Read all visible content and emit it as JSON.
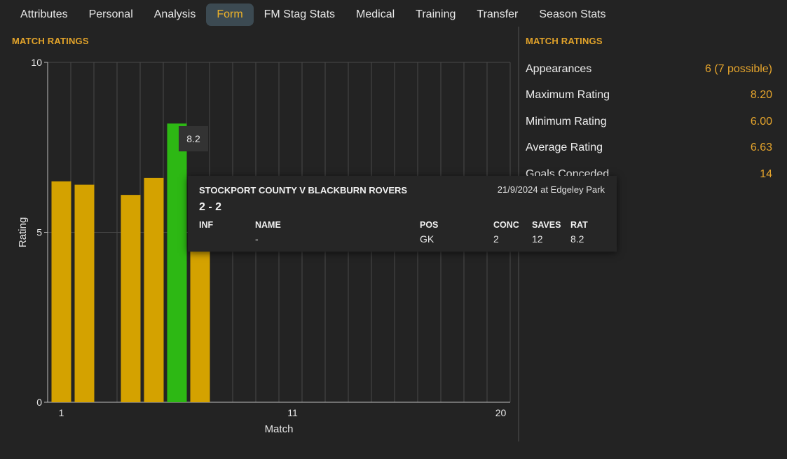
{
  "tabs": [
    {
      "label": "Attributes"
    },
    {
      "label": "Personal"
    },
    {
      "label": "Analysis"
    },
    {
      "label": "Form",
      "active": true
    },
    {
      "label": "FM Stag Stats"
    },
    {
      "label": "Medical"
    },
    {
      "label": "Training"
    },
    {
      "label": "Transfer"
    },
    {
      "label": "Season Stats"
    }
  ],
  "left_title": "MATCH RATINGS",
  "right_title": "MATCH RATINGS",
  "stats": [
    {
      "label": "Appearances",
      "value": "6 (7 possible)"
    },
    {
      "label": "Maximum Rating",
      "value": "8.20"
    },
    {
      "label": "Minimum Rating",
      "value": "6.00"
    },
    {
      "label": "Average Rating",
      "value": "6.63"
    },
    {
      "label": "Goals Conceded",
      "value": "14"
    }
  ],
  "chart_data": {
    "type": "bar",
    "xlabel": "Match",
    "ylabel": "Rating",
    "x_ticks": [
      "1",
      "11",
      "20"
    ],
    "y_ticks": [
      "0",
      "5",
      "10"
    ],
    "ylim": [
      0,
      10
    ],
    "xlim": [
      1,
      20
    ],
    "matches": [
      1,
      2,
      3,
      4,
      5,
      6,
      7
    ],
    "values": [
      6.5,
      6.4,
      null,
      6.1,
      6.6,
      8.2,
      5.0
    ],
    "highlight_index": 5,
    "colors": {
      "bar": "#d4a200",
      "highlight": "#2db814",
      "grid": "#4a4a4a",
      "axis": "#bdbdbd"
    }
  },
  "hover_value": "8.2",
  "popup": {
    "title": "STOCKPORT COUNTY V BLACKBURN ROVERS",
    "date": "21/9/2024 at Edgeley Park",
    "score": "2 - 2",
    "headers": {
      "inf": "INF",
      "name": "NAME",
      "pos": "POS",
      "conc": "CONC",
      "saves": "SAVES",
      "rat": "RAT"
    },
    "row": {
      "name": "-",
      "pos": "GK",
      "conc": "2",
      "saves": "12",
      "rat": "8.2"
    }
  }
}
